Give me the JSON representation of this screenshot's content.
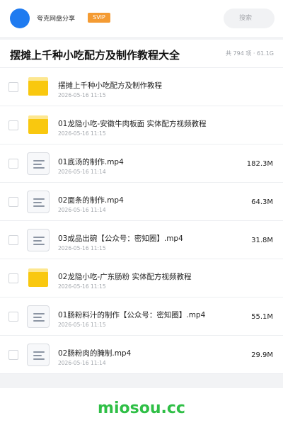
{
  "header": {
    "username": "夸克网盘分享",
    "badge": "SVIP",
    "search_placeholder": "搜索",
    "accent_color": "#1f7bf0",
    "badge_color": "#f49b33"
  },
  "title": {
    "text": "摆摊上千种小吃配方及制作教程大全",
    "summary": "共 794 项 · 61.1G"
  },
  "items": [
    {
      "name": "摆摊上千种小吃配方及制作教程",
      "date": "2026-05-16 11:15",
      "size": "",
      "icon": "folder-icon"
    },
    {
      "name": "01龙隐小吃-安徽牛肉板面 实体配方视频教程",
      "date": "2026-05-16 11:15",
      "size": "",
      "icon": "folder-icon"
    },
    {
      "name": "01底汤的制作.mp4",
      "date": "2026-05-16 11:14",
      "size": "182.3M",
      "icon": "file-icon"
    },
    {
      "name": "02面条的制作.mp4",
      "date": "2026-05-16 11:14",
      "size": "64.3M",
      "icon": "file-icon"
    },
    {
      "name": "03成品出碗【公众号：密知圈】.mp4",
      "date": "2026-05-16 11:15",
      "size": "31.8M",
      "icon": "file-icon"
    },
    {
      "name": "02龙隐小吃-广东肠粉 实体配方视频教程",
      "date": "2026-05-16 11:15",
      "size": "",
      "icon": "folder-icon"
    },
    {
      "name": "01肠粉料汁的制作【公众号：密知圈】.mp4",
      "date": "2026-05-16 11:15",
      "size": "55.1M",
      "icon": "file-icon"
    },
    {
      "name": "02肠粉肉的腌制.mp4",
      "date": "2026-05-16 11:14",
      "size": "29.9M",
      "icon": "file-icon"
    }
  ],
  "watermark": "miosou.cc"
}
